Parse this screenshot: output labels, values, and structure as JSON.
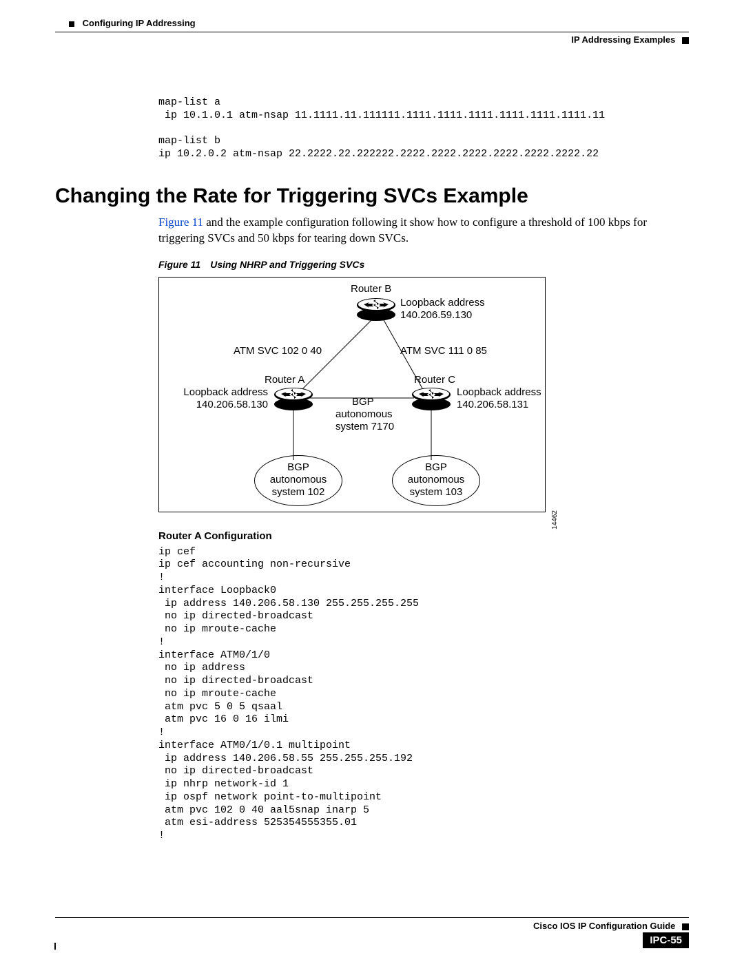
{
  "header": {
    "chapter": "Configuring IP Addressing",
    "section": "IP Addressing Examples"
  },
  "codeblock1": "map-list a\n ip 10.1.0.1 atm-nsap 11.1111.11.111111.1111.1111.1111.1111.1111.1111.11\n\nmap-list b\nip 10.2.0.2 atm-nsap 22.2222.22.222222.2222.2222.2222.2222.2222.2222.22",
  "heading": "Changing the Rate for Triggering SVCs Example",
  "figref": "Figure 11",
  "paragraph_rest": " and the example configuration following it show how to configure a threshold of 100 kbps for triggering SVCs and 50 kbps for tearing down SVCs.",
  "figcaption": "Figure 11 Using NHRP and Triggering SVCs",
  "figure": {
    "routerB_label": "Router B",
    "routerB_loop1": "Loopback address",
    "routerB_loop2": "140.206.59.130",
    "svc_left": "ATM SVC 102 0 40",
    "svc_right": "ATM SVC 111 0 85",
    "routerA_label": "Router A",
    "routerA_loop1": "Loopback address",
    "routerA_loop2": "140.206.58.130",
    "routerC_label": "Router C",
    "routerC_loop1": "Loopback address",
    "routerC_loop2": "140.206.58.131",
    "center_bgp1": "BGP",
    "center_bgp2": "autonomous",
    "center_bgp3": "system 7170",
    "ellipseL1": "BGP",
    "ellipseL2": "autonomous",
    "ellipseL3": "system 102",
    "ellipseR1": "BGP",
    "ellipseR2": "autonomous",
    "ellipseR3": "system 103",
    "diag_id": "14462"
  },
  "subhead": "Router A Configuration",
  "codeblock2": "ip cef\nip cef accounting non-recursive\n!\ninterface Loopback0\n ip address 140.206.58.130 255.255.255.255\n no ip directed-broadcast\n no ip mroute-cache\n!\ninterface ATM0/1/0\n no ip address\n no ip directed-broadcast\n no ip mroute-cache\n atm pvc 5 0 5 qsaal\n atm pvc 16 0 16 ilmi\n!\ninterface ATM0/1/0.1 multipoint\n ip address 140.206.58.55 255.255.255.192\n no ip directed-broadcast\n ip nhrp network-id 1\n ip ospf network point-to-multipoint \n atm pvc 102 0 40 aal5snap inarp 5\n atm esi-address 525354555355.01\n!",
  "footer": {
    "title": "Cisco IOS IP Configuration Guide",
    "page": "IPC-55"
  }
}
